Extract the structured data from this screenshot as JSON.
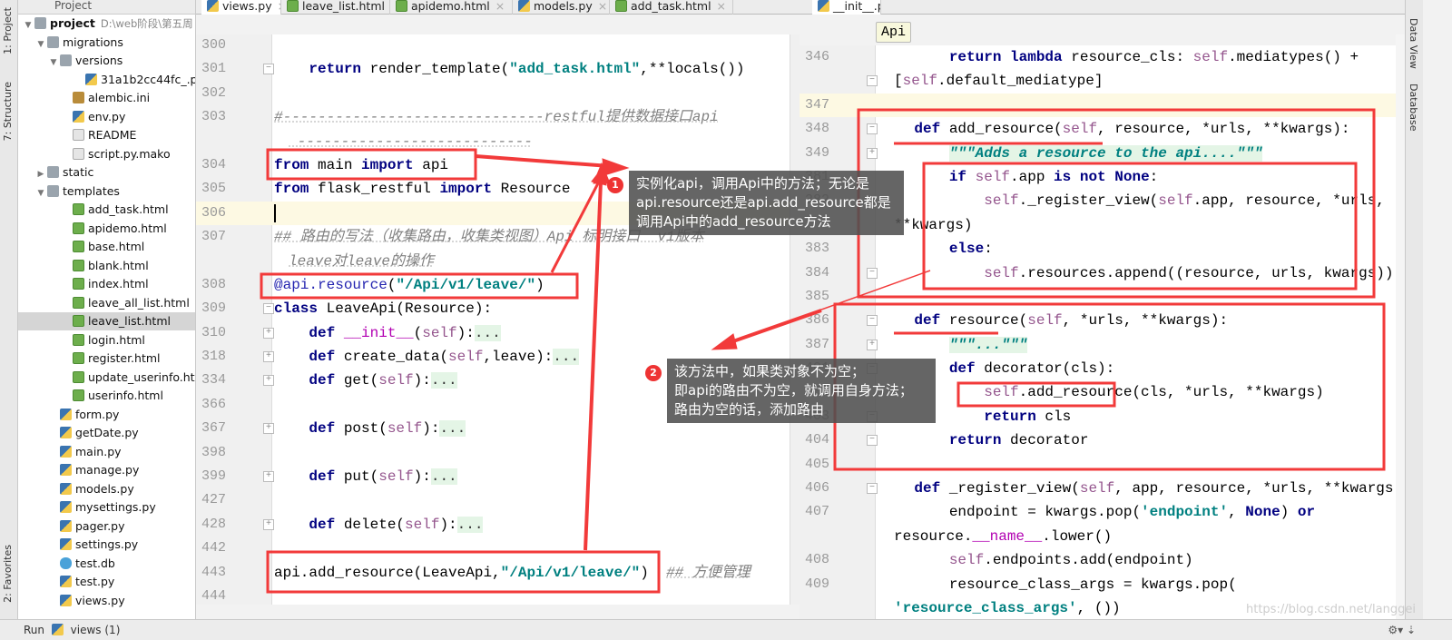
{
  "side_tabs": {
    "project": "1: Project",
    "structure": "7: Structure",
    "favorites": "2: Favorites",
    "data_view": "Data View",
    "database": "Database"
  },
  "project_panel": {
    "header": "Project",
    "items": [
      {
        "label": "project",
        "hint": "D:\\web阶段\\第五周",
        "icon": "folder",
        "depth": 0,
        "expand": "open",
        "bold": true
      },
      {
        "label": "migrations",
        "icon": "folder",
        "depth": 1,
        "expand": "open"
      },
      {
        "label": "versions",
        "icon": "folder",
        "depth": 2,
        "expand": "open"
      },
      {
        "label": "31a1b2cc44fc_.py",
        "icon": "py",
        "depth": 4
      },
      {
        "label": "alembic.ini",
        "icon": "ini",
        "depth": 3
      },
      {
        "label": "env.py",
        "icon": "py",
        "depth": 3
      },
      {
        "label": "README",
        "icon": "file",
        "depth": 3
      },
      {
        "label": "script.py.mako",
        "icon": "file",
        "depth": 3
      },
      {
        "label": "static",
        "icon": "folder",
        "depth": 1,
        "expand": "closed"
      },
      {
        "label": "templates",
        "icon": "folder",
        "depth": 1,
        "expand": "open"
      },
      {
        "label": "add_task.html",
        "icon": "html",
        "depth": 3
      },
      {
        "label": "apidemo.html",
        "icon": "html",
        "depth": 3
      },
      {
        "label": "base.html",
        "icon": "html",
        "depth": 3
      },
      {
        "label": "blank.html",
        "icon": "html",
        "depth": 3
      },
      {
        "label": "index.html",
        "icon": "html",
        "depth": 3
      },
      {
        "label": "leave_all_list.html",
        "icon": "html",
        "depth": 3
      },
      {
        "label": "leave_list.html",
        "icon": "html",
        "depth": 3,
        "selected": true
      },
      {
        "label": "login.html",
        "icon": "html",
        "depth": 3
      },
      {
        "label": "register.html",
        "icon": "html",
        "depth": 3
      },
      {
        "label": "update_userinfo.html",
        "icon": "html",
        "depth": 3
      },
      {
        "label": "userinfo.html",
        "icon": "html",
        "depth": 3
      },
      {
        "label": "form.py",
        "icon": "py",
        "depth": 2
      },
      {
        "label": "getDate.py",
        "icon": "py",
        "depth": 2
      },
      {
        "label": "main.py",
        "icon": "py",
        "depth": 2
      },
      {
        "label": "manage.py",
        "icon": "py",
        "depth": 2
      },
      {
        "label": "models.py",
        "icon": "py",
        "depth": 2
      },
      {
        "label": "mysettings.py",
        "icon": "py",
        "depth": 2
      },
      {
        "label": "pager.py",
        "icon": "py",
        "depth": 2
      },
      {
        "label": "settings.py",
        "icon": "py",
        "depth": 2
      },
      {
        "label": "test.db",
        "icon": "db",
        "depth": 2
      },
      {
        "label": "test.py",
        "icon": "py",
        "depth": 2
      },
      {
        "label": "views.py",
        "icon": "py",
        "depth": 2
      }
    ]
  },
  "left_tabs": [
    {
      "label": "views.py",
      "icon": "py",
      "active": true
    },
    {
      "label": "leave_list.html",
      "icon": "html"
    },
    {
      "label": "apidemo.html",
      "icon": "html"
    },
    {
      "label": "models.py",
      "icon": "py"
    },
    {
      "label": "add_task.html",
      "icon": "html"
    }
  ],
  "right_tabs": [
    {
      "label": "__init__.py",
      "icon": "py",
      "active": true
    }
  ],
  "breadcrumb_tip": "Api",
  "left_editor": {
    "lines": [
      {
        "n": "300",
        "segs": []
      },
      {
        "n": "301",
        "fold": "-",
        "segs": [
          [
            "",
            "    "
          ],
          [
            "kw",
            "return"
          ],
          [
            "",
            " render_template("
          ],
          [
            "str",
            "\"add_task.html\""
          ],
          [
            "",
            ",**locals())"
          ]
        ]
      },
      {
        "n": "302",
        "segs": []
      },
      {
        "n": "303",
        "segs": [
          [
            "cm",
            "#------------------------------restful提供数据接口api"
          ]
        ]
      },
      {
        "n": "",
        "wrap": true,
        "segs": [
          [
            "cm",
            " ---------------------------"
          ]
        ]
      },
      {
        "n": "304",
        "segs": [
          [
            "kw",
            "from"
          ],
          [
            "",
            " main "
          ],
          [
            "kw",
            "import"
          ],
          [
            "",
            " api"
          ]
        ]
      },
      {
        "n": "305",
        "segs": [
          [
            "kw",
            "from"
          ],
          [
            "",
            " flask_restful "
          ],
          [
            "kw",
            "import"
          ],
          [
            "",
            " Resource"
          ]
        ]
      },
      {
        "n": "306",
        "hl": true,
        "caret": true,
        "segs": []
      },
      {
        "n": "307",
        "segs": [
          [
            "cm",
            "## 路由的写法（收集路由，收集类视图）Api 标明接口  v1版本"
          ]
        ]
      },
      {
        "n": "",
        "wrap": true,
        "segs": [
          [
            "cm",
            "leave对leave的操作"
          ]
        ]
      },
      {
        "n": "308",
        "segs": [
          [
            "deco",
            "@api.resource"
          ],
          [
            "",
            "("
          ],
          [
            "str",
            "\"/Api/v1/leave/\""
          ],
          [
            "",
            ")"
          ]
        ]
      },
      {
        "n": "309",
        "fold": "-",
        "segs": [
          [
            "kw",
            "class"
          ],
          [
            "",
            " LeaveApi(Resource):"
          ]
        ]
      },
      {
        "n": "310",
        "fold": "+",
        "segs": [
          [
            "",
            "    "
          ],
          [
            "kw",
            "def"
          ],
          [
            "",
            " "
          ],
          [
            "dun",
            "__init__"
          ],
          [
            "",
            "("
          ],
          [
            "self",
            "self"
          ],
          [
            "",
            "):"
          ],
          [
            "fold",
            "..."
          ]
        ]
      },
      {
        "n": "318",
        "fold": "+",
        "segs": [
          [
            "",
            "    "
          ],
          [
            "kw",
            "def"
          ],
          [
            "",
            " create_data("
          ],
          [
            "self",
            "self"
          ],
          [
            "",
            ",leave):"
          ],
          [
            "fold",
            "..."
          ]
        ]
      },
      {
        "n": "334",
        "fold": "+",
        "segs": [
          [
            "",
            "    "
          ],
          [
            "kw",
            "def"
          ],
          [
            "",
            " get("
          ],
          [
            "self",
            "self"
          ],
          [
            "",
            "):"
          ],
          [
            "fold",
            "..."
          ]
        ]
      },
      {
        "n": "366",
        "segs": []
      },
      {
        "n": "367",
        "fold": "+",
        "segs": [
          [
            "",
            "    "
          ],
          [
            "kw",
            "def"
          ],
          [
            "",
            " post("
          ],
          [
            "self",
            "self"
          ],
          [
            "",
            "):"
          ],
          [
            "fold",
            "..."
          ]
        ]
      },
      {
        "n": "398",
        "segs": []
      },
      {
        "n": "399",
        "fold": "+",
        "segs": [
          [
            "",
            "    "
          ],
          [
            "kw",
            "def"
          ],
          [
            "",
            " put("
          ],
          [
            "self",
            "self"
          ],
          [
            "",
            "):"
          ],
          [
            "fold",
            "..."
          ]
        ]
      },
      {
        "n": "427",
        "segs": []
      },
      {
        "n": "428",
        "fold": "+",
        "segs": [
          [
            "",
            "    "
          ],
          [
            "kw",
            "def"
          ],
          [
            "",
            " delete("
          ],
          [
            "self",
            "self"
          ],
          [
            "",
            "):"
          ],
          [
            "fold",
            "..."
          ]
        ]
      },
      {
        "n": "442",
        "segs": []
      },
      {
        "n": "443",
        "segs": [
          [
            "",
            "api.add_resource(LeaveApi,"
          ],
          [
            "str",
            "\"/Api/v1/leave/\""
          ],
          [
            "",
            ")  "
          ],
          [
            "cm",
            "## 方便管理"
          ]
        ]
      },
      {
        "n": "444",
        "segs": []
      }
    ]
  },
  "right_editor": {
    "lines": [
      {
        "n": "346",
        "segs": [
          [
            "",
            "        "
          ],
          [
            "kw",
            "return lambda"
          ],
          [
            "",
            " resource_cls: "
          ],
          [
            "self",
            "self"
          ],
          [
            "",
            ".mediatypes() +"
          ]
        ]
      },
      {
        "n": "",
        "wrap": true,
        "fold": "-",
        "segs": [
          [
            "",
            "["
          ],
          [
            "self",
            "self"
          ],
          [
            "",
            ".default_mediatype]"
          ]
        ]
      },
      {
        "n": "347",
        "hl": true,
        "segs": []
      },
      {
        "n": "348",
        "fold": "-",
        "segs": [
          [
            "",
            "    "
          ],
          [
            "kw",
            "def"
          ],
          [
            "",
            " add_resource("
          ],
          [
            "self",
            "self"
          ],
          [
            "",
            ", resource, *urls, **kwargs):"
          ]
        ]
      },
      {
        "n": "349",
        "fold": "+",
        "segs": [
          [
            "",
            "        "
          ],
          [
            "doc",
            "\"\"\"Adds a resource to the api....\"\"\""
          ]
        ]
      },
      {
        "n": "381",
        "segs": [
          [
            "",
            "        "
          ],
          [
            "kw",
            "if"
          ],
          [
            "",
            " "
          ],
          [
            "self",
            "self"
          ],
          [
            "",
            ".app "
          ],
          [
            "kw",
            "is not None"
          ],
          [
            "",
            ":"
          ]
        ]
      },
      {
        "n": "382",
        "segs": [
          [
            "",
            "            "
          ],
          [
            "self",
            "self"
          ],
          [
            "",
            "._register_view("
          ],
          [
            "self",
            "self"
          ],
          [
            "",
            ".app, resource, *urls,"
          ]
        ]
      },
      {
        "n": "",
        "wrap": true,
        "segs": [
          [
            "",
            "**kwargs)"
          ]
        ]
      },
      {
        "n": "383",
        "segs": [
          [
            "",
            "        "
          ],
          [
            "kw",
            "else"
          ],
          [
            "",
            ":"
          ]
        ]
      },
      {
        "n": "384",
        "fold": "-",
        "segs": [
          [
            "",
            "            "
          ],
          [
            "self",
            "self"
          ],
          [
            "",
            ".resources.append((resource, urls, kwargs))"
          ]
        ]
      },
      {
        "n": "385",
        "segs": []
      },
      {
        "n": "386",
        "fold": "-",
        "segs": [
          [
            "",
            "    "
          ],
          [
            "kw",
            "def"
          ],
          [
            "",
            " resource("
          ],
          [
            "self",
            "self"
          ],
          [
            "",
            ", *urls, **kwargs):"
          ]
        ]
      },
      {
        "n": "387",
        "fold": "+",
        "segs": [
          [
            "",
            "        "
          ],
          [
            "doc",
            "\"\"\"...\"\"\""
          ]
        ]
      },
      {
        "n": "401",
        "fold": "-",
        "segs": [
          [
            "",
            "        "
          ],
          [
            "kw",
            "def"
          ],
          [
            "",
            " decorator(cls):"
          ]
        ]
      },
      {
        "n": "402",
        "segs": [
          [
            "",
            "            "
          ],
          [
            "self",
            "self"
          ],
          [
            "",
            ".add_resource(cls, *urls, **kwargs)"
          ]
        ]
      },
      {
        "n": "403",
        "fold": "-",
        "segs": [
          [
            "",
            "            "
          ],
          [
            "kw",
            "return"
          ],
          [
            "",
            " cls"
          ]
        ]
      },
      {
        "n": "404",
        "fold": "-",
        "segs": [
          [
            "",
            "        "
          ],
          [
            "kw",
            "return"
          ],
          [
            "",
            " decorator"
          ]
        ]
      },
      {
        "n": "405",
        "segs": []
      },
      {
        "n": "406",
        "fold": "-",
        "segs": [
          [
            "",
            "    "
          ],
          [
            "kw",
            "def"
          ],
          [
            "",
            " _register_view("
          ],
          [
            "self",
            "self"
          ],
          [
            "",
            ", app, resource, *urls, **kwargs):"
          ]
        ]
      },
      {
        "n": "407",
        "segs": [
          [
            "",
            "        endpoint = kwargs.pop("
          ],
          [
            "str",
            "'endpoint'"
          ],
          [
            "",
            ", "
          ],
          [
            "kw",
            "None"
          ],
          [
            "",
            ") "
          ],
          [
            "kw",
            "or"
          ]
        ]
      },
      {
        "n": "",
        "wrap": true,
        "segs": [
          [
            "",
            "resource."
          ],
          [
            "dun",
            "__name__"
          ],
          [
            "",
            ".lower()"
          ]
        ]
      },
      {
        "n": "408",
        "segs": [
          [
            "",
            "        "
          ],
          [
            "self",
            "self"
          ],
          [
            "",
            ".endpoints.add(endpoint)"
          ]
        ]
      },
      {
        "n": "409",
        "segs": [
          [
            "",
            "        resource_class_args = kwargs.pop("
          ]
        ]
      },
      {
        "n": "",
        "wrap": true,
        "segs": [
          [
            "str",
            "'resource_class_args'"
          ],
          [
            "",
            ", ())"
          ]
        ]
      }
    ]
  },
  "annotations": [
    {
      "badge": "1",
      "lines": [
        "实例化api，调用Api中的方法；无论是",
        "api.resource还是api.add_resource都是",
        "调用Api中的add_resource方法"
      ]
    },
    {
      "badge": "2",
      "lines": [
        "该方法中，如果类对象不为空；",
        "即api的路由不为空，就调用自身方法；",
        "路由为空的话，添加路由"
      ]
    }
  ],
  "bottom": {
    "run_label": "Run",
    "run_target": "views (1)"
  },
  "watermark": "https://blog.csdn.net/langgei",
  "colors": {
    "annotation_red": "#f23a3a",
    "keyword": "#000080",
    "string": "#008080",
    "self": "#94558d"
  }
}
